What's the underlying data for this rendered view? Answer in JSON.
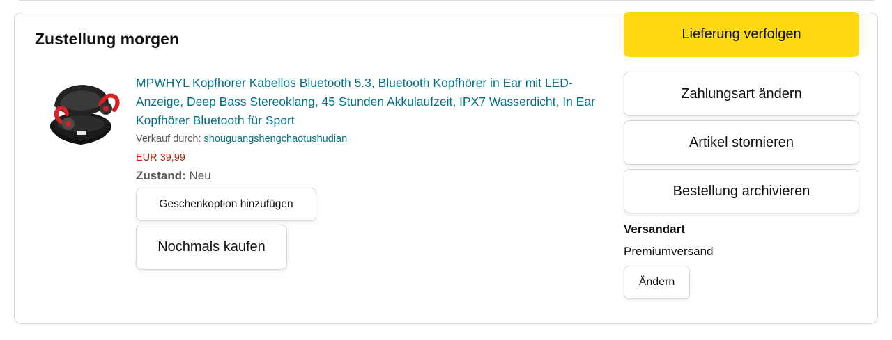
{
  "delivery": {
    "title": "Zustellung morgen"
  },
  "product": {
    "image_icon": "wireless-earbuds-product-image",
    "title": "MPWHYL Kopfhörer Kabellos Bluetooth 5.3, Bluetooth Kopfhörer in Ear mit LED-Anzeige, Deep Bass Stereoklang, 45 Stunden Akkulaufzeit, IPX7 Wasserdicht, In Ear Kopfhörer Bluetooth für Sport",
    "seller_prefix": "Verkauf durch:",
    "seller_name": "shouguangshengchaotushudian",
    "price": "EUR 39,99",
    "condition_label": "Zustand:",
    "condition_value": "Neu"
  },
  "actions": {
    "gift_option": "Geschenkoption hinzufügen",
    "buy_again": "Nochmals kaufen",
    "track": "Lieferung verfolgen",
    "change_payment": "Zahlungsart ändern",
    "cancel_item": "Artikel stornieren",
    "archive_order": "Bestellung archivieren"
  },
  "shipping": {
    "label": "Versandart",
    "value": "Premiumversand",
    "change": "Ändern"
  },
  "colors": {
    "link": "#007185",
    "price": "#b12704",
    "primary_button": "#ffd814",
    "border": "#d5d9d9"
  }
}
